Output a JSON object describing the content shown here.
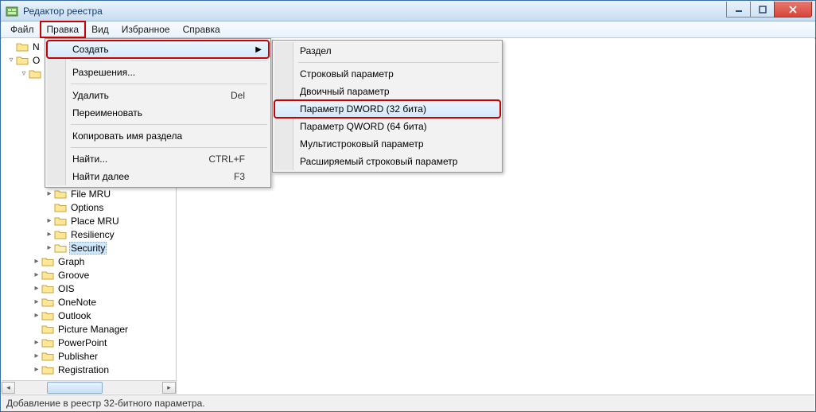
{
  "window": {
    "title": "Редактор реестра"
  },
  "menubar": {
    "items": [
      "Файл",
      "Правка",
      "Вид",
      "Избранное",
      "Справка"
    ],
    "highlighted_index": 1
  },
  "tree": {
    "top_cut": [
      {
        "indent": 0,
        "expander": "",
        "label": "N"
      },
      {
        "indent": 0,
        "expander": "▿",
        "label": "O"
      },
      {
        "indent": 1,
        "expander": "▿",
        "label": ""
      }
    ],
    "mid_cut": [
      {
        "indent": 2,
        "expander": "",
        "label": ""
      },
      {
        "indent": 1,
        "expander": "▿",
        "label": ""
      }
    ],
    "visible": [
      {
        "indent": 3,
        "expander": "▸",
        "label": "File MRU"
      },
      {
        "indent": 3,
        "expander": " ",
        "label": "Options"
      },
      {
        "indent": 3,
        "expander": "▸",
        "label": "Place MRU"
      },
      {
        "indent": 3,
        "expander": "▸",
        "label": "Resiliency"
      },
      {
        "indent": 3,
        "expander": "▸",
        "label": "Security",
        "selected": true
      },
      {
        "indent": 2,
        "expander": "▸",
        "label": "Graph"
      },
      {
        "indent": 2,
        "expander": "▸",
        "label": "Groove"
      },
      {
        "indent": 2,
        "expander": "▸",
        "label": "OIS"
      },
      {
        "indent": 2,
        "expander": "▸",
        "label": "OneNote"
      },
      {
        "indent": 2,
        "expander": "▸",
        "label": "Outlook"
      },
      {
        "indent": 2,
        "expander": " ",
        "label": "Picture Manager"
      },
      {
        "indent": 2,
        "expander": "▸",
        "label": "PowerPoint"
      },
      {
        "indent": 2,
        "expander": "▸",
        "label": "Publisher"
      },
      {
        "indent": 2,
        "expander": "▸",
        "label": "Registration"
      }
    ]
  },
  "edit_menu": {
    "items": [
      {
        "label": "Создать",
        "submenu": true,
        "hovered": true,
        "red": true
      },
      {
        "sep": true
      },
      {
        "label": "Разрешения..."
      },
      {
        "sep": true
      },
      {
        "label": "Удалить",
        "shortcut": "Del"
      },
      {
        "label": "Переименовать"
      },
      {
        "sep": true
      },
      {
        "label": "Копировать имя раздела"
      },
      {
        "sep": true
      },
      {
        "label": "Найти...",
        "shortcut": "CTRL+F"
      },
      {
        "label": "Найти далее",
        "shortcut": "F3"
      }
    ]
  },
  "new_submenu": {
    "items": [
      {
        "label": "Раздел"
      },
      {
        "sep": true
      },
      {
        "label": "Строковый параметр"
      },
      {
        "label": "Двоичный параметр"
      },
      {
        "label": "Параметр DWORD (32 бита)",
        "hovered": true,
        "red": true
      },
      {
        "label": "Параметр QWORD (64 бита)"
      },
      {
        "label": "Мультистроковый параметр"
      },
      {
        "label": "Расширяемый строковый параметр"
      }
    ]
  },
  "statusbar": {
    "text": "Добавление в реестр 32-битного параметра."
  }
}
